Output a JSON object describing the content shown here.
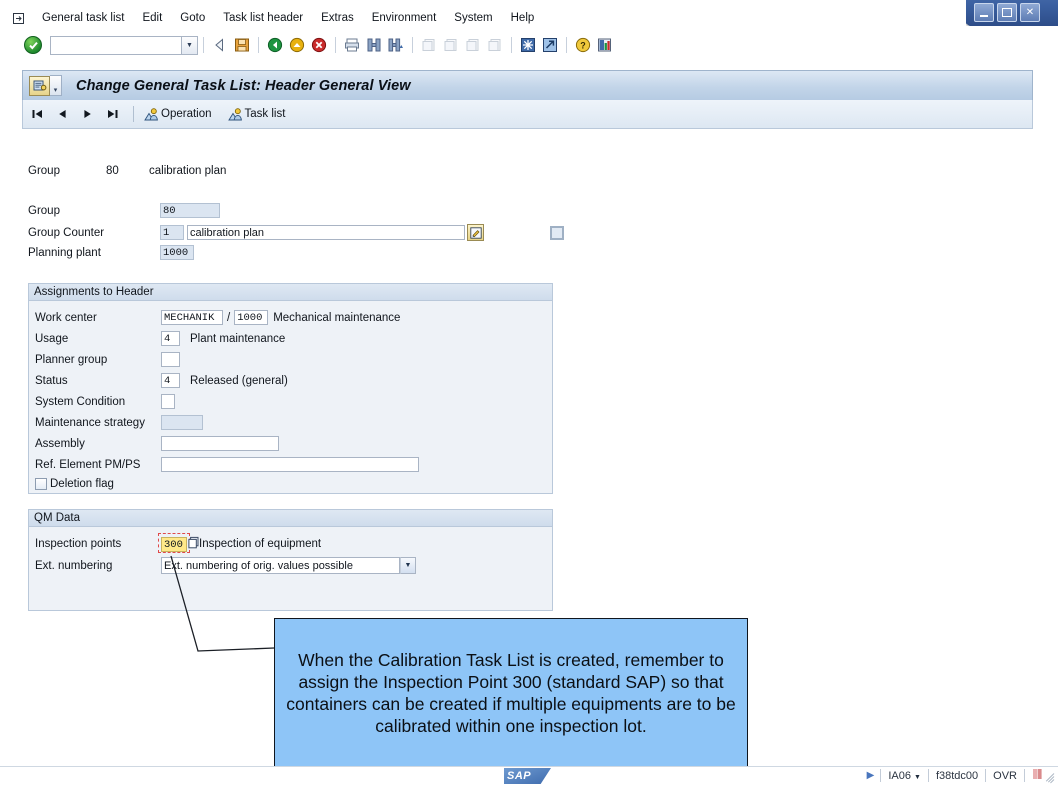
{
  "window": {
    "controls": [
      {
        "name": "minimize",
        "glyph": "_"
      },
      {
        "name": "maximize",
        "glyph": "□"
      },
      {
        "name": "close",
        "glyph": "✕"
      }
    ]
  },
  "menubar": {
    "system_icon": "sap-session-icon",
    "items": [
      {
        "label": "General task list",
        "accel_index": 3
      },
      {
        "label": "Edit",
        "accel_index": 0
      },
      {
        "label": "Goto",
        "accel_index": 0
      },
      {
        "label": "Task list header",
        "accel_index": 3
      },
      {
        "label": "Extras",
        "accel_index": 4
      },
      {
        "label": "Environment",
        "accel_index": 2
      },
      {
        "label": "System",
        "accel_index": 1
      },
      {
        "label": "Help",
        "accel_index": 0
      }
    ]
  },
  "functionbar": {
    "ok_icon": "green-check-icon",
    "command_field_value": "",
    "command_field_placeholder": "",
    "dropdown_icon": "chevron-down-icon",
    "buttons": [
      {
        "name": "enter-back-icon",
        "title": "Enter"
      },
      {
        "name": "save-icon",
        "title": "Save"
      },
      {
        "name": "back-green-arrow-icon",
        "title": "Back"
      },
      {
        "name": "exit-yellow-arrow-icon",
        "title": "Exit"
      },
      {
        "name": "cancel-red-x-icon",
        "title": "Cancel"
      },
      {
        "name": "print-icon",
        "title": "Print"
      },
      {
        "name": "find-icon",
        "title": "Find"
      },
      {
        "name": "find-next-icon",
        "title": "Find Next"
      },
      {
        "name": "first-page-icon",
        "title": "First Page"
      },
      {
        "name": "previous-page-icon",
        "title": "Previous Page"
      },
      {
        "name": "next-page-icon",
        "title": "Next Page"
      },
      {
        "name": "last-page-icon",
        "title": "Last Page"
      },
      {
        "name": "create-session-icon",
        "title": "Create New Session"
      },
      {
        "name": "shortcut-icon",
        "title": "Create Shortcut"
      },
      {
        "name": "help-icon",
        "title": "Help"
      },
      {
        "name": "layout-menu-icon",
        "title": "Customize Local Layout"
      }
    ]
  },
  "screen": {
    "icon": "task-list-header-icon",
    "title": "Change General Task List: Header General View"
  },
  "apptoolbar": {
    "nav": [
      {
        "name": "first-record-button",
        "glyph": "first"
      },
      {
        "name": "previous-record-button",
        "glyph": "prev"
      },
      {
        "name": "next-record-button",
        "glyph": "next"
      },
      {
        "name": "last-record-button",
        "glyph": "last"
      }
    ],
    "buttons": [
      {
        "name": "operation-button",
        "label": "Operation",
        "icon": "person-overview-icon"
      },
      {
        "name": "task-list-button",
        "label": "Task list",
        "icon": "person-overview-icon"
      }
    ]
  },
  "header_summary": {
    "group_label": "Group",
    "group_value": "80",
    "group_text": "calibration plan"
  },
  "general_fields": {
    "group": {
      "label": "Group",
      "value": "80"
    },
    "group_counter": {
      "label": "Group Counter",
      "value": "1",
      "description": "calibration plan",
      "edit_icon": "long-text-edit-icon",
      "checkbox_checked": false
    },
    "planning_plant": {
      "label": "Planning plant",
      "value": "1000"
    }
  },
  "assignments": {
    "title": "Assignments to Header",
    "work_center": {
      "label": "Work center",
      "value": "MECHANIK",
      "separator": "/",
      "plant": "1000",
      "description": "Mechanical maintenance"
    },
    "usage": {
      "label": "Usage",
      "value": "4",
      "description": "Plant maintenance"
    },
    "planner_group": {
      "label": "Planner group",
      "value": "",
      "description": ""
    },
    "status": {
      "label": "Status",
      "value": "4",
      "description": "Released (general)"
    },
    "system_condition": {
      "label": "System Condition",
      "value": ""
    },
    "maintenance_strategy": {
      "label": "Maintenance strategy",
      "value": ""
    },
    "assembly": {
      "label": "Assembly",
      "value": ""
    },
    "ref_element": {
      "label": "Ref. Element PM/PS",
      "value": ""
    },
    "deletion_flag": {
      "label": "Deletion flag",
      "checked": false
    }
  },
  "qm_data": {
    "title": "QM Data",
    "inspection_points": {
      "label": "Inspection points",
      "value": "300",
      "description": "Inspection of equipment",
      "picker_icon": "value-help-icon",
      "highlighted": true,
      "highlight_color": "#ffe98a",
      "marker_color": "#e04a4a"
    },
    "ext_numbering": {
      "label": "Ext. numbering",
      "selected": "Ext. numbering of orig. values possible",
      "dropdown_icon": "chevron-down-icon"
    }
  },
  "callout": {
    "text": "When the Calibration Task List is created, remember to assign the Inspection Point 300 (standard SAP) so that containers can be created if multiple equipments are to be calibrated within one inspection lot.",
    "background": "#8ec5f7",
    "border": "#10161e"
  },
  "statusbar": {
    "logo": "SAP",
    "servicing_icon": "status-expand-icon",
    "transaction": "IA06",
    "transaction_caret": "chevron-down-icon",
    "system": "f38tdc00",
    "insert_mode": "OVR",
    "session_icon": "session-indicator-icon"
  }
}
